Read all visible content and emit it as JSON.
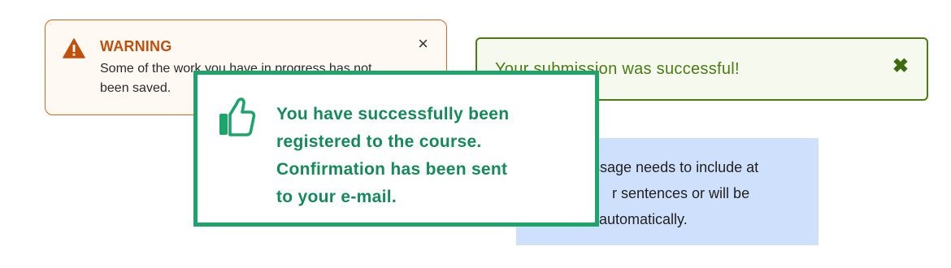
{
  "warning": {
    "title": "WARNING",
    "message_line1": "Some of the work you have in progress has not",
    "message_line2": "been saved.",
    "close": "×",
    "icon": "warning-triangle-icon",
    "color": "#c0500a"
  },
  "success": {
    "message": "Your submission was successful!",
    "close": "✖",
    "color": "#4a7c12"
  },
  "info": {
    "line1": "ssage needs to include at",
    "line2": "r sentences or will be",
    "line3": "automatically.",
    "color": "#cfe0fd"
  },
  "confirmation": {
    "icon": "thumbs-up-icon",
    "line1": "You have successfully been",
    "line2": "registered to the course.",
    "line3": "Confirmation has been sent",
    "line4": "to your e-mail.",
    "color": "#1da46b"
  }
}
